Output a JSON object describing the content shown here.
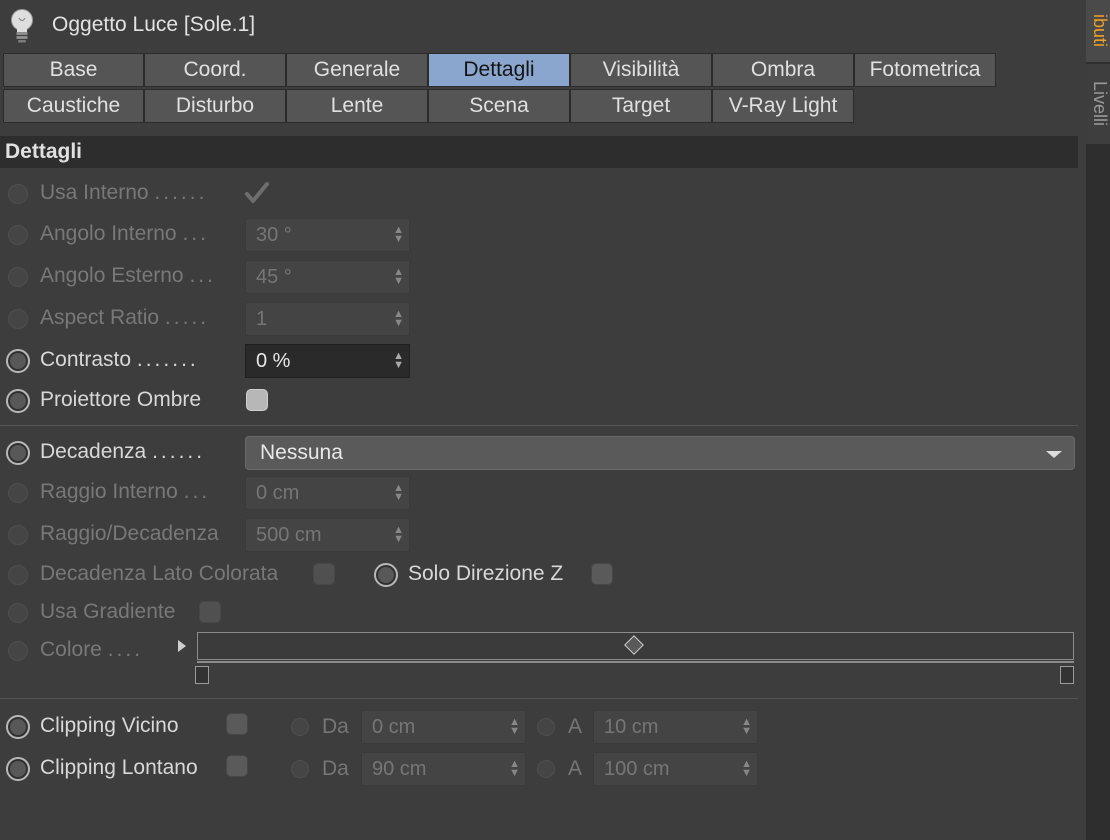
{
  "header": {
    "title": "Oggetto Luce [Sole.1]",
    "icon": "lightbulb-icon"
  },
  "tabs_row1": [
    "Base",
    "Coord.",
    "Generale",
    "Dettagli",
    "Visibilità",
    "Ombra",
    "Fotometrica"
  ],
  "tabs_row2": [
    "Caustiche",
    "Disturbo",
    "Lente",
    "Scena",
    "Target",
    "V-Ray Light"
  ],
  "active_tab": "Dettagli",
  "sidebar": {
    "tab1": "ibuti",
    "tab2": "Livelli"
  },
  "section_title": "Dettagli",
  "fields": {
    "usa_interno": {
      "label": "Usa Interno",
      "dots": "......"
    },
    "angolo_interno": {
      "label": "Angolo Interno",
      "dots": "...",
      "value": "30 °"
    },
    "angolo_esterno": {
      "label": "Angolo Esterno",
      "dots": "...",
      "value": "45 °"
    },
    "aspect_ratio": {
      "label": "Aspect Ratio",
      "dots": ".....",
      "value": "1"
    },
    "contrasto": {
      "label": "Contrasto",
      "dots": ".......",
      "value": "0 %"
    },
    "proiettore_ombre": {
      "label": "Proiettore Ombre"
    },
    "decadenza": {
      "label": "Decadenza",
      "dots": "......",
      "value": "Nessuna"
    },
    "raggio_interno": {
      "label": "Raggio Interno",
      "dots": "...",
      "value": "0 cm"
    },
    "raggio_decadenza": {
      "label": "Raggio/Decadenza",
      "value": "500 cm"
    },
    "decadenza_lato": {
      "label": "Decadenza Lato Colorata"
    },
    "solo_direzione_z": {
      "label": "Solo Direzione Z"
    },
    "usa_gradiente": {
      "label": "Usa Gradiente"
    },
    "colore": {
      "label": "Colore",
      "dots": "...."
    },
    "clipping_vicino": {
      "label": "Clipping Vicino",
      "da_label": "Da",
      "da_value": "0 cm",
      "a_label": "A",
      "a_value": "10 cm"
    },
    "clipping_lontano": {
      "label": "Clipping Lontano",
      "da_label": "Da",
      "da_value": "90 cm",
      "a_label": "A",
      "a_value": "100 cm"
    }
  },
  "colors": {
    "background": "#3d3d3d",
    "active_tab": "#8aa6ce",
    "sidebar_accent": "#f0a028"
  }
}
